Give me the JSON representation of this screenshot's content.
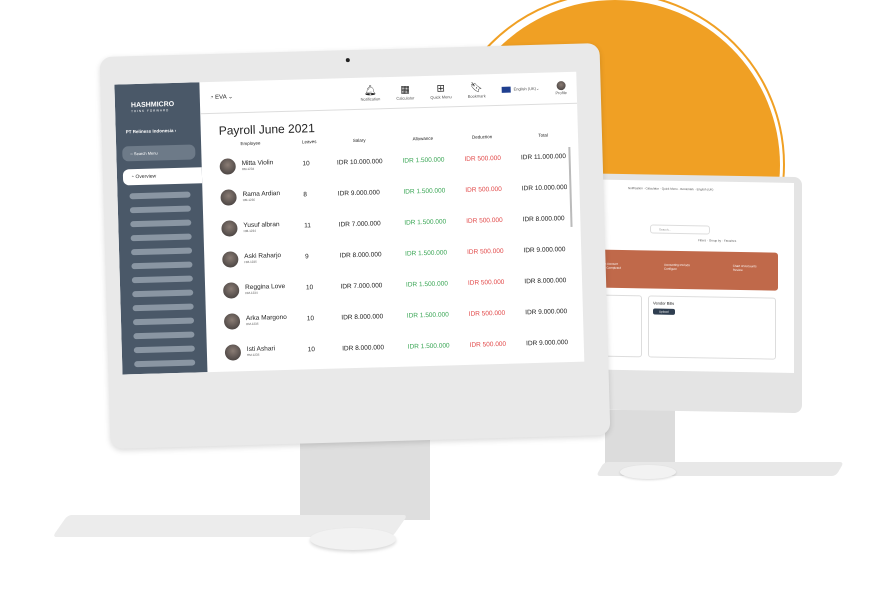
{
  "brand": {
    "name": "HASHMICRO",
    "tagline": "THINK FORWARD"
  },
  "sidebar": {
    "company": "PT Reliness Indonesia",
    "search_placeholder": "Search Menu",
    "active": "Overview"
  },
  "header": {
    "module": "EVA",
    "toolbar": [
      {
        "icon": "bell-icon",
        "label": "Notification"
      },
      {
        "icon": "calculator-icon",
        "label": "Calculator"
      },
      {
        "icon": "grid-icon",
        "label": "Quick Menu"
      },
      {
        "icon": "bookmark-icon",
        "label": "Bookmark"
      }
    ],
    "language": "English (UK)",
    "profile": "Profile"
  },
  "page": {
    "title": "Payroll June 2021"
  },
  "table": {
    "columns": [
      "Employee",
      "Leaves",
      "Salary",
      "Allowance",
      "Deduction",
      "Total"
    ],
    "rows": [
      {
        "name": "Mitta Violin",
        "id": "HM-1234",
        "leaves": "10",
        "salary": "IDR 10.000.000",
        "allowance": "IDR 1.500.000",
        "deduction": "IDR 500.000",
        "total": "IDR 11.000.000"
      },
      {
        "name": "Rama Ardian",
        "id": "HM-1235",
        "leaves": "8",
        "salary": "IDR 9.000.000",
        "allowance": "IDR 1.500.000",
        "deduction": "IDR 500.000",
        "total": "IDR 10.000.000"
      },
      {
        "name": "Yusuf albran",
        "id": "HM-1234",
        "leaves": "11",
        "salary": "IDR 7.000.000",
        "allowance": "IDR 1.500.000",
        "deduction": "IDR 500.000",
        "total": "IDR 8.000.000"
      },
      {
        "name": "Aski Raharjo",
        "id": "HM-1235",
        "leaves": "9",
        "salary": "IDR 8.000.000",
        "allowance": "IDR 1.500.000",
        "deduction": "IDR 500.000",
        "total": "IDR 9.000.000"
      },
      {
        "name": "Reggina Love",
        "id": "HM-1234",
        "leaves": "10",
        "salary": "IDR 7.000.000",
        "allowance": "IDR 1.500.000",
        "deduction": "IDR 500.000",
        "total": "IDR 8.000.000"
      },
      {
        "name": "Arka Margono",
        "id": "HM-1235",
        "leaves": "10",
        "salary": "IDR 8.000.000",
        "allowance": "IDR 1.500.000",
        "deduction": "IDR 500.000",
        "total": "IDR 9.000.000"
      },
      {
        "name": "Isti Ashari",
        "id": "HM-1235",
        "leaves": "10",
        "salary": "IDR 8.000.000",
        "allowance": "IDR 1.500.000",
        "deduction": "IDR 500.000",
        "total": "IDR 9.000.000"
      }
    ]
  },
  "second_screen": {
    "search_placeholder": "Search...",
    "filters": "Filters",
    "group_by": "Group by",
    "favorites": "Favorites",
    "steps": [
      "Bank Account",
      "Accounting Periods",
      "Chart of Accounts"
    ],
    "step_done": "Step Completed",
    "configure": "Configure",
    "review": "Review",
    "card_title": "Vendor Bills",
    "upload": "Upload"
  },
  "colors": {
    "accent": "#f0a024",
    "sidebar": "#4a5868",
    "allowance": "#3aa655",
    "deduction": "#e24a4a",
    "banner": "#c0694a"
  }
}
